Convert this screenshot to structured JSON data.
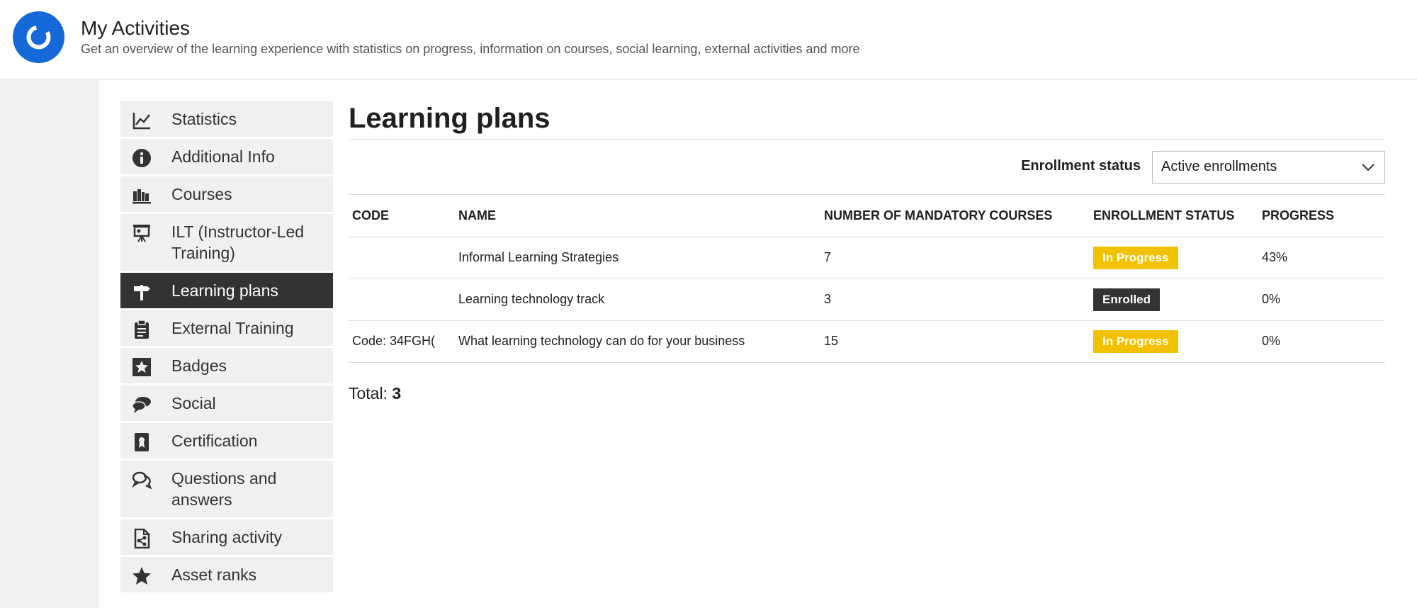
{
  "header": {
    "title": "My Activities",
    "subtitle": "Get an overview of the learning experience with statistics on progress, information on courses, social learning, external activities and more"
  },
  "sidebar": {
    "items": [
      {
        "label": "Statistics",
        "icon": "chart-line-icon"
      },
      {
        "label": "Additional Info",
        "icon": "info-circle-icon"
      },
      {
        "label": "Courses",
        "icon": "books-icon"
      },
      {
        "label": "ILT (Instructor-Led Training)",
        "icon": "presentation-board-icon"
      },
      {
        "label": "Learning plans",
        "icon": "signpost-icon",
        "active": true
      },
      {
        "label": "External Training",
        "icon": "clipboard-icon"
      },
      {
        "label": "Badges",
        "icon": "star-badge-icon"
      },
      {
        "label": "Social",
        "icon": "chat-bubbles-icon"
      },
      {
        "label": "Certification",
        "icon": "certificate-icon"
      },
      {
        "label": "Questions and answers",
        "icon": "question-bubbles-icon"
      },
      {
        "label": "Sharing activity",
        "icon": "share-document-icon"
      },
      {
        "label": "Asset ranks",
        "icon": "star-icon"
      }
    ]
  },
  "main": {
    "title": "Learning plans",
    "filter": {
      "label": "Enrollment status",
      "selected": "Active enrollments"
    },
    "table": {
      "columns": [
        "CODE",
        "NAME",
        "NUMBER OF MANDATORY COURSES",
        "ENROLLMENT STATUS",
        "PROGRESS"
      ],
      "rows": [
        {
          "code": "",
          "name": "Informal Learning Strategies",
          "courses": "7",
          "status": "In Progress",
          "progress": "43%"
        },
        {
          "code": "",
          "name": "Learning technology track",
          "courses": "3",
          "status": "Enrolled",
          "progress": "0%"
        },
        {
          "code": "Code: 34FGH(",
          "name": "What learning technology can do for your business",
          "courses": "15",
          "status": "In Progress",
          "progress": "0%"
        }
      ]
    },
    "total_label": "Total:",
    "total_value": "3"
  },
  "colors": {
    "brand_blue": "#1468d8",
    "in_progress": "#f2c200",
    "enrolled": "#333333",
    "active_nav": "#333333"
  }
}
